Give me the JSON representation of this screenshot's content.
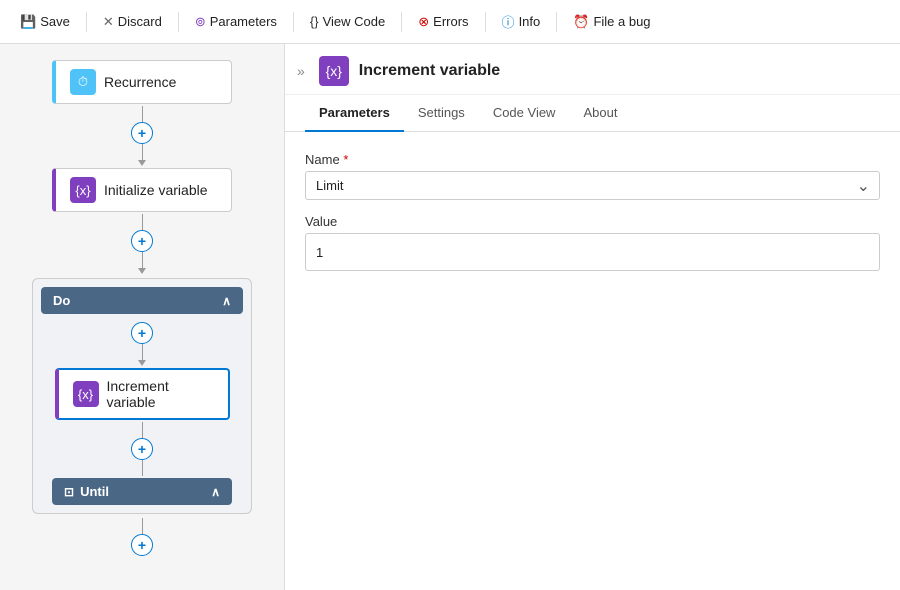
{
  "toolbar": {
    "save_label": "Save",
    "discard_label": "Discard",
    "parameters_label": "Parameters",
    "view_code_label": "View Code",
    "errors_label": "Errors",
    "info_label": "Info",
    "file_bug_label": "File a bug"
  },
  "canvas": {
    "recurrence_label": "Recurrence",
    "init_variable_label": "Initialize variable",
    "do_label": "Do",
    "increment_label": "Increment variable",
    "until_label": "Until"
  },
  "panel": {
    "title": "Increment variable",
    "tabs": [
      "Parameters",
      "Settings",
      "Code View",
      "About"
    ],
    "active_tab": "Parameters",
    "name_label": "Name",
    "name_required": "*",
    "name_value": "Limit",
    "value_label": "Value",
    "value_value": "1"
  }
}
